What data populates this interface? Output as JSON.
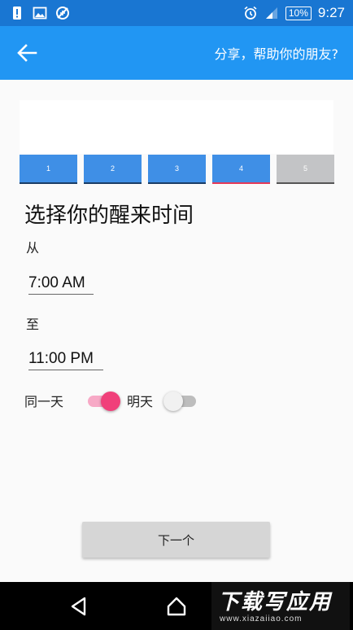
{
  "status_bar": {
    "battery": "10%",
    "time": "9:27",
    "icons": [
      "alert-icon",
      "image-icon",
      "data-saver-icon",
      "alarm-icon",
      "signal-icon",
      "battery-icon"
    ],
    "color": "#1976d2"
  },
  "app_bar": {
    "share_text": "分享，帮助你的朋友?",
    "back_icon": "arrow-left-icon",
    "color": "#2196f3"
  },
  "steps": [
    {
      "label": "1"
    },
    {
      "label": "2"
    },
    {
      "label": "3"
    },
    {
      "label": "4",
      "active": true
    },
    {
      "label": "5",
      "disabled": true
    }
  ],
  "main": {
    "title": "选择你的醒来时间",
    "from_label": "从",
    "from_time": "7:00 AM",
    "to_label": "至",
    "to_time": "11:00 PM",
    "same_day_label": "同一天",
    "same_day_on": true,
    "next_day_label": "明天",
    "next_day_on": false,
    "accent": "#f0407a"
  },
  "next_button": {
    "label": "下一个"
  },
  "nav_bar": {
    "icons": [
      "back-triangle-icon",
      "home-icon"
    ]
  },
  "watermark": {
    "main": "下载写应用",
    "sub": "www.xiazaiiao.com"
  }
}
